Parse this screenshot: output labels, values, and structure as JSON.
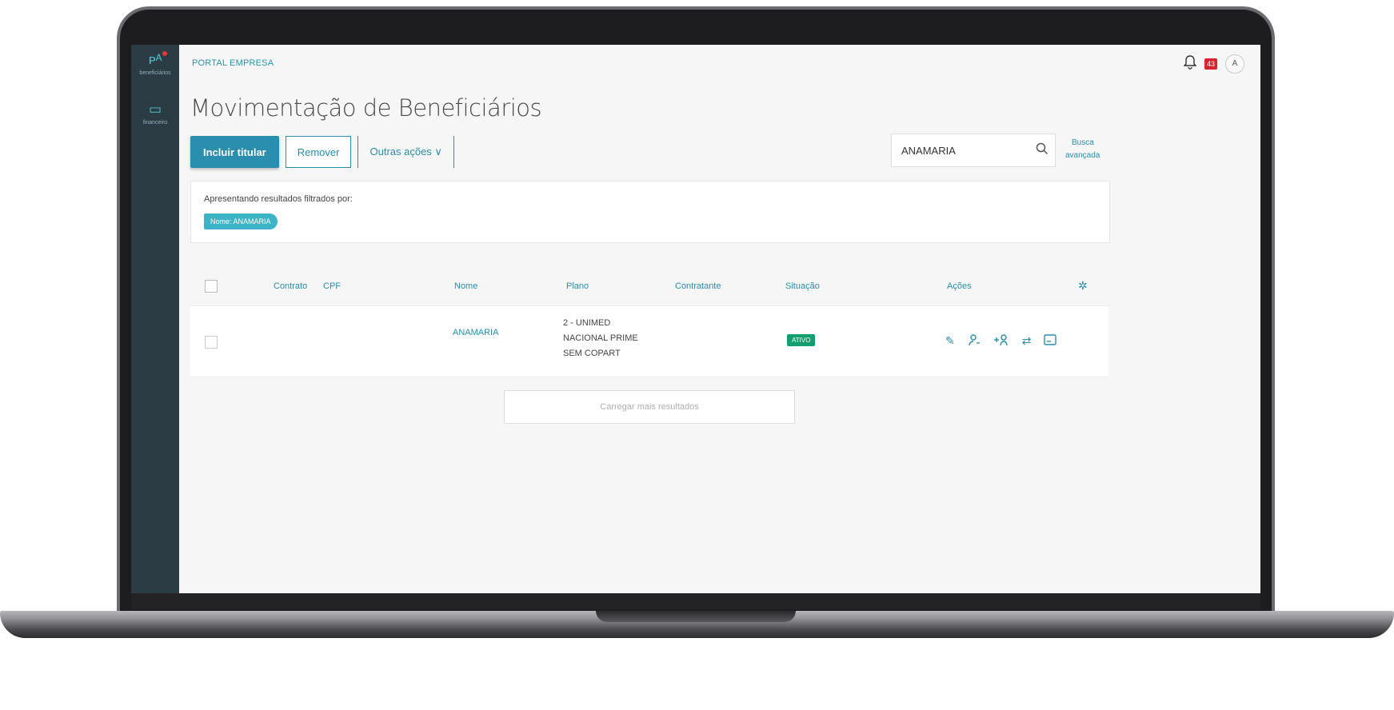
{
  "sidebar": {
    "items": [
      {
        "icon": "people-icon",
        "glyph": "ᴩᴬ",
        "label": "beneficiários"
      },
      {
        "icon": "card-icon",
        "glyph": "▭",
        "label": "financeiro"
      }
    ]
  },
  "header": {
    "brand": "PORTAL EMPRESA",
    "notification_count": "43",
    "avatar_initial": "A"
  },
  "page": {
    "title": "Movimentação de Beneficiários"
  },
  "toolbar": {
    "include_label": "Incluir titular",
    "remove_label": "Remover",
    "more_label": "Outras ações ∨"
  },
  "search": {
    "value": "ANAMARIA",
    "advanced_line1": "Busca",
    "advanced_line2": "avançada"
  },
  "filters": {
    "label": "Apresentando resultados filtrados por:",
    "chip": "Nome: ANAMARIA"
  },
  "table": {
    "columns": [
      "Contrato",
      "CPF",
      "Nome",
      "Plano",
      "Contratante",
      "Situação",
      "Ações"
    ],
    "rows": [
      {
        "contrato": "",
        "cpf": "",
        "nome": "ANAMARIA",
        "plano_line1": "2 - UNIMED",
        "plano_line2": "NACIONAL PRIME",
        "plano_line3": "SEM COPART",
        "contratante": "",
        "situacao": "ATIVO"
      }
    ]
  },
  "load_more": "Carregar mais resultados",
  "colors": {
    "accent": "#2a8eae",
    "sidebar": "#2c3c44",
    "status_active": "#11a06e",
    "badge": "#d9232e"
  }
}
